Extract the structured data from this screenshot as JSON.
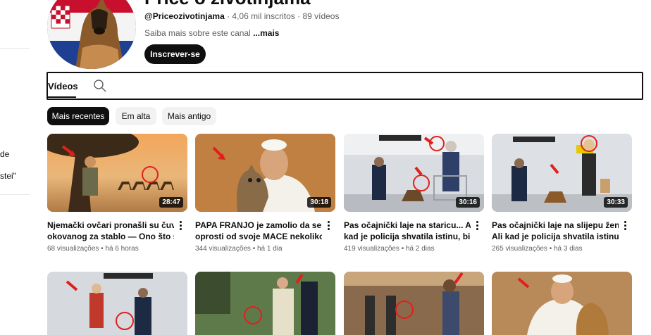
{
  "sidebar": {
    "fragments": [
      "de",
      "stei\""
    ]
  },
  "channel": {
    "title": "Priče o životinjama",
    "handle": "@Priceozivotinjama",
    "stats": " · 4,06 mil inscritos · 89 vídeos",
    "about": "Saiba mais sobre este canal ",
    "about_more": "...mais",
    "subscribe_label": "Inscrever-se"
  },
  "tabs": {
    "videos_label": "Vídeos"
  },
  "chips": [
    {
      "label": "Mais recentes",
      "active": true
    },
    {
      "label": "Em alta",
      "active": false
    },
    {
      "label": "Mais antigo",
      "active": false
    }
  ],
  "videos": [
    {
      "title_line1": "Njemački ovčari pronašli su čuvara",
      "title_line2": "okovanog za stablo — Ono što su...",
      "meta": "68 visualizações • há 6 horas",
      "duration": "28:47"
    },
    {
      "title_line1": "PAPA FRANJO je zamolio da se",
      "title_line2": "oprosti od svoje MACE nekoliko...",
      "meta": "344 visualizações • há 1 dia",
      "duration": "30:18"
    },
    {
      "title_line1": "Pas očajnički laje na staricu... Ali",
      "title_line2": "kad je policija shvatila istinu, bilo j...",
      "meta": "419 visualizações • há 2 dias",
      "duration": "30:16"
    },
    {
      "title_line1": "Pas očajnički laje na slijepu ženu...",
      "title_line2": "Ali kad je policija shvatila istinu, bil...",
      "meta": "265 visualizações • há 3 dias",
      "duration": "30:33"
    }
  ],
  "colors": {
    "subscribe_bg": "#0f0f0f",
    "chip_active_bg": "#0f0f0f",
    "chip_bg": "#f2f2f2",
    "meta_text": "#606060",
    "annotation_red": "#e0201c"
  }
}
